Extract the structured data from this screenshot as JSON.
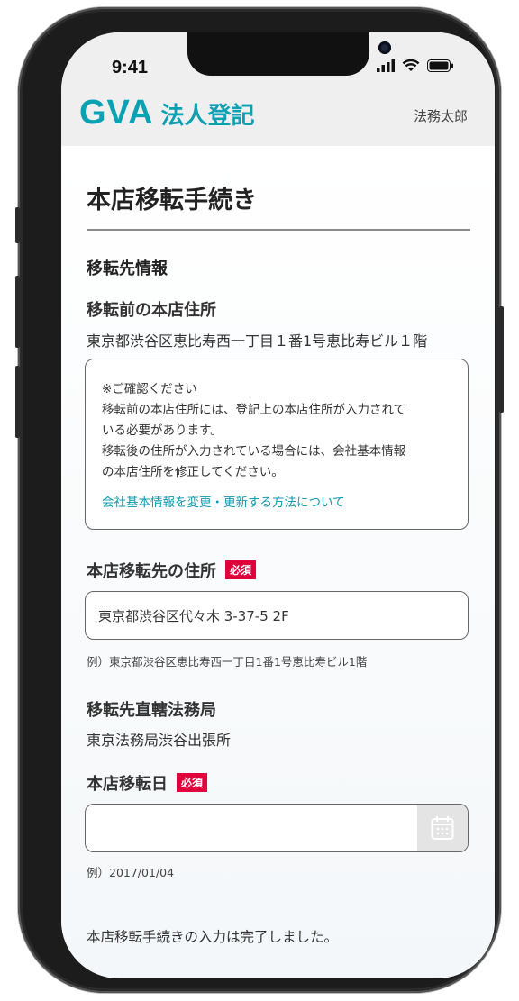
{
  "status_bar": {
    "time": "9:41"
  },
  "header": {
    "logo_mark": "GVA",
    "logo_text": "法人登記",
    "user_name": "法務太郎"
  },
  "page": {
    "title": "本店移転手続き",
    "section_title": "移転先情報"
  },
  "previous_address": {
    "label": "移転前の本店住所",
    "value": "東京都渋谷区恵比寿西一丁目１番1号恵比寿ビル１階"
  },
  "notice": {
    "heading": "※ご確認ください",
    "line1": "移転前の本店住所には、登記上の本店住所が入力されて",
    "line2": "いる必要があります。",
    "line3": "移転後の住所が入力されている場合には、会社基本情報",
    "line4": "の本店住所を修正してください。",
    "link": "会社基本情報を変更・更新する方法について"
  },
  "new_address": {
    "label": "本店移転先の住所",
    "required": "必須",
    "value": "東京都渋谷区代々木 3-37-5 2F",
    "hint": "例）東京都渋谷区恵比寿西一丁目1番1号恵比寿ビル1階"
  },
  "jurisdiction": {
    "label": "移転先直轄法務局",
    "value": "東京法務局渋谷出張所"
  },
  "move_date": {
    "label": "本店移転日",
    "required": "必須",
    "value": "",
    "hint": "例）2017/01/04"
  },
  "completion_message": "本店移転手続きの入力は完了しました。",
  "colors": {
    "brand": "#0aa1b3",
    "required_badge": "#e0003c",
    "header_bg": "#efefef",
    "link": "#0a9bb0"
  },
  "icons": {
    "calendar": "calendar-icon",
    "signal": "signal-icon",
    "wifi": "wifi-icon",
    "battery": "battery-icon"
  }
}
